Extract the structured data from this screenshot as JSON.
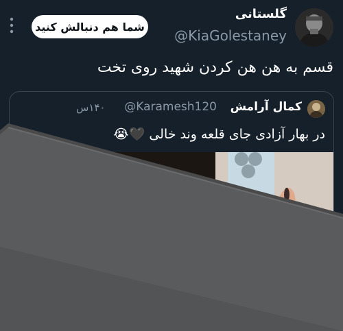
{
  "author": {
    "name": "گلستانی",
    "handle": "@KiaGolestaney",
    "avatar_icon": "profile-photo"
  },
  "actions": {
    "follow_label": "شما هم دنبالش کنید",
    "more_icon": "more-vertical-icon"
  },
  "tweet": {
    "text": "قسم به هن هن کردن شهید روی تخت"
  },
  "quoted_tweet": {
    "author_name": "کمال آرامش",
    "handle": "@Karamesh120",
    "time": "۱۴۰س",
    "text": "در بهار آزادی جای قلعه وند خالی 🖤😭"
  },
  "colors": {
    "background": "#15202b",
    "follow_button_bg": "#ffffff",
    "secondary_text": "#8b98a5",
    "border": "#38444d"
  }
}
